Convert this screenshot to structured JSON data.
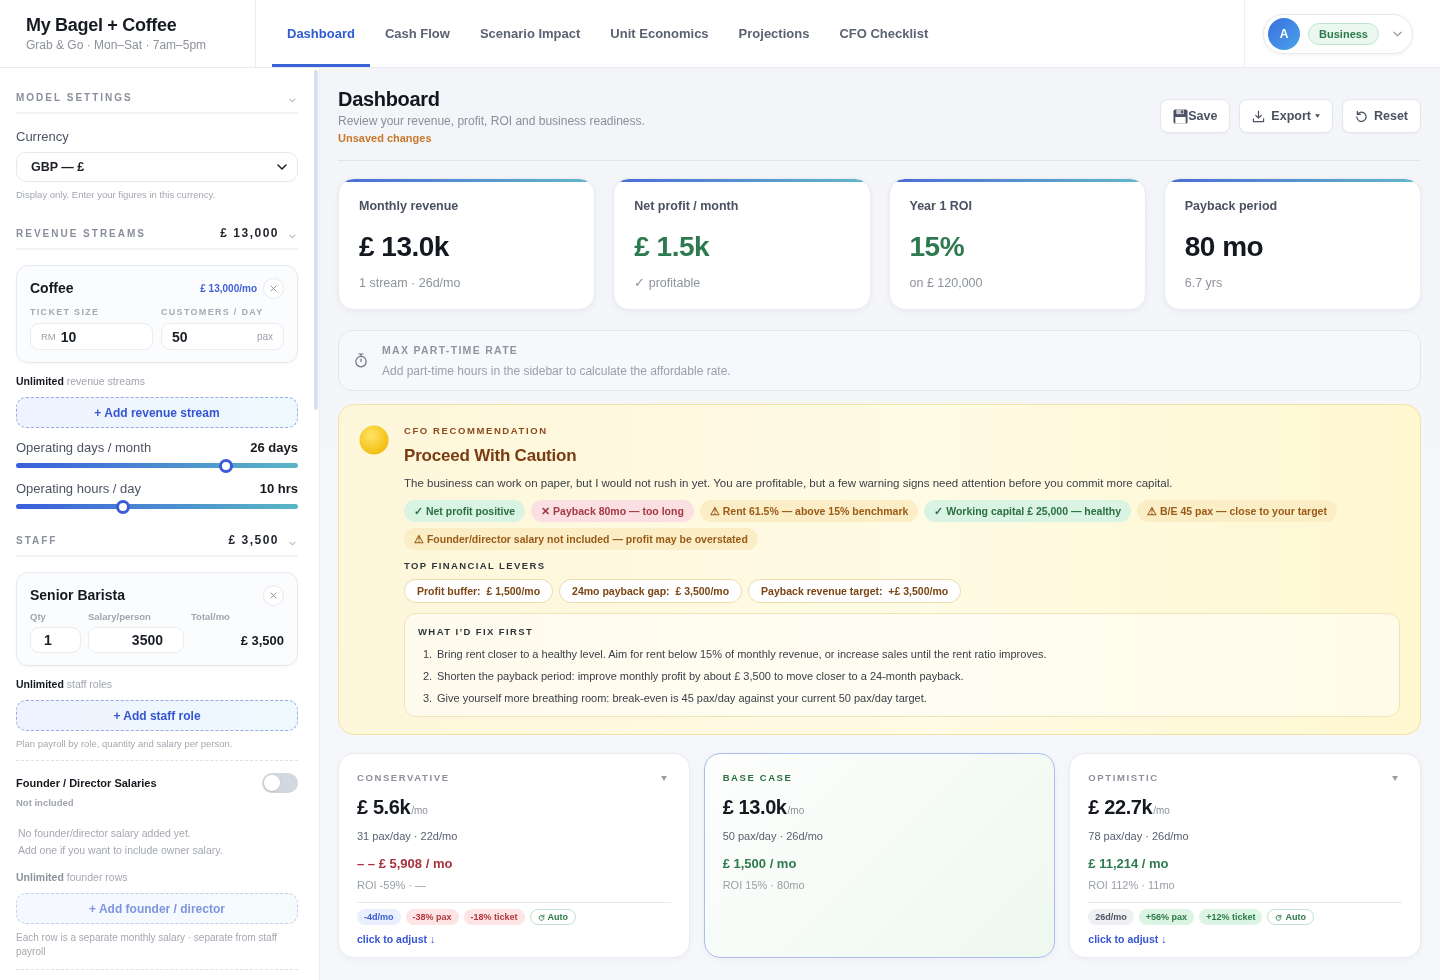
{
  "brand": {
    "title": "My Bagel + Coffee",
    "subtitle": "Grab & Go · Mon–Sat · 7am–5pm"
  },
  "tabs": [
    {
      "label": "Dashboard",
      "selected": true
    },
    {
      "label": "Cash Flow",
      "selected": false
    },
    {
      "label": "Scenario Impact",
      "selected": false
    },
    {
      "label": "Unit Economics",
      "selected": false
    },
    {
      "label": "Projections",
      "selected": false
    },
    {
      "label": "CFO Checklist",
      "selected": false
    }
  ],
  "account": {
    "avatar": "A",
    "plan": "Business"
  },
  "sidebar": {
    "model_settings": {
      "title": "MODEL SETTINGS",
      "currency_label": "Currency",
      "currency_value": "GBP — £",
      "currency_hint": "Display only. Enter your figures in this currency."
    },
    "revenue": {
      "title": "REVENUE STREAMS",
      "total": "£ 13,000",
      "streams": [
        {
          "name": "Coffee",
          "monthly": "£ 13,000/mo",
          "ticket_label": "TICKET SIZE",
          "ticket_prefix": "RM",
          "ticket_value": "10",
          "customers_label": "CUSTOMERS / DAY",
          "customers_value": "50",
          "customers_unit": "pax"
        }
      ],
      "limit_note": "**Unlimited** revenue streams",
      "add_label": "+ Add revenue stream"
    },
    "sliders": [
      {
        "label": "Operating days / month",
        "reading": "26 days",
        "level": 0.745
      },
      {
        "label": "Operating hours / day",
        "reading": "10 hrs",
        "level": 0.38
      }
    ],
    "staff": {
      "title": "STAFF",
      "total": "£ 3,500",
      "roles": [
        {
          "name": "Senior Barista",
          "qty_label": "Qty",
          "qty": "1",
          "salary_label": "Salary/person",
          "salary": "3500",
          "total_label": "Total/mo",
          "total": "£ 3,500"
        }
      ],
      "limit_note": "**Unlimited** staff roles",
      "add_label": "+ Add staff role",
      "hint": "Plan payroll by role, quantity and salary per person."
    },
    "founders": {
      "title": "Founder / Director Salaries",
      "on": false,
      "status": "Not included",
      "empty_lines": [
        "No founder/director salary added yet.",
        "Add one if you want to include owner salary."
      ],
      "limit_note": "**Unlimited** founder rows",
      "add_label": "+ Add founder / director",
      "hint": "Each row is a separate monthly salary · separate from staff payroll"
    }
  },
  "page": {
    "title": "Dashboard",
    "subtitle": "Review your revenue, profit, ROI and business readiness.",
    "status": "Unsaved changes"
  },
  "actions": [
    {
      "label": "Save",
      "kind": "save"
    },
    {
      "label": "Export",
      "kind": "export"
    },
    {
      "label": "Reset",
      "kind": "reset"
    }
  ],
  "kpis": [
    {
      "label": "Monthly revenue",
      "value": "£ 13.0k",
      "note": "1 stream · 26d/mo",
      "kind": "plain"
    },
    {
      "label": "Net profit / month",
      "value": "£ 1.5k",
      "note": "✓ profitable",
      "kind": "positive"
    },
    {
      "label": "Year 1 ROI",
      "value": "15%",
      "note": "on £ 120,000",
      "kind": "positive"
    },
    {
      "label": "Payback period",
      "value": "80 mo",
      "note": "6.7 yrs",
      "kind": "plain"
    }
  ],
  "part_time": {
    "title": "MAX PART-TIME RATE",
    "text": "Add part-time hours in the sidebar to calculate the affordable rate."
  },
  "recommendation": {
    "eyebrow": "CFO RECOMMENDATION",
    "title": "Proceed With Caution",
    "summary": "The business can work on paper, but I would not rush in yet. You are profitable, but a few warning signs need attention before you commit more capital.",
    "signals": [
      {
        "text": "✓ Net profit positive",
        "kind": "good"
      },
      {
        "text": "✕ Payback 80mo — too long",
        "kind": "bad"
      },
      {
        "text": "⚠ Rent 61.5% — above 15% benchmark",
        "kind": "warn"
      },
      {
        "text": "✓ Working capital £ 25,000 — healthy",
        "kind": "good"
      },
      {
        "text": "⚠ B/E 45 pax — close to your target",
        "kind": "warn"
      },
      {
        "text": "⚠ Founder/director salary not included — profit may be overstated",
        "kind": "warn"
      }
    ],
    "levers_title": "TOP FINANCIAL LEVERS",
    "levers": [
      "Profit buffer:  £ 1,500/mo",
      "24mo payback gap:  £ 3,500/mo",
      "Payback revenue target:  +£ 3,500/mo"
    ],
    "fix": {
      "title": "WHAT I’D FIX FIRST",
      "items": [
        {
          "number": "1.",
          "text": "Bring rent closer to a healthy level. Aim for rent below 15% of monthly revenue, or increase sales until the rent ratio improves."
        },
        {
          "number": "2.",
          "text": "Shorten the payback period: improve monthly profit by about £ 3,500 to move closer to a 24-month payback."
        },
        {
          "number": "3.",
          "text": "Give yourself more breathing room: break-even is 45 pax/day against your current 50 pax/day target."
        }
      ]
    }
  },
  "scenarios": [
    {
      "title": "CONSERVATIVE",
      "selected": false,
      "kind": "loss",
      "revenue": "£ 5.6k",
      "unit": "/mo",
      "meta": "31 pax/day · 22d/mo",
      "profit": "– – £ 5,908 / mo",
      "roi": "ROI -59% · —",
      "adjusters": [
        {
          "text": "-4d/mo",
          "kind": "shift"
        },
        {
          "text": "-38% pax",
          "kind": "down"
        },
        {
          "text": "-18% ticket",
          "kind": "down"
        },
        {
          "text": "Auto",
          "kind": "auto"
        }
      ],
      "link": "click to adjust ↓"
    },
    {
      "title": "BASE CASE",
      "selected": true,
      "kind": "gain",
      "revenue": "£ 13.0k",
      "unit": "/mo",
      "meta": "50 pax/day · 26d/mo",
      "profit": "£ 1,500 / mo",
      "roi": "ROI 15% · 80mo"
    },
    {
      "title": "OPTIMISTIC",
      "selected": false,
      "kind": "gain",
      "revenue": "£ 22.7k",
      "unit": "/mo",
      "meta": "78 pax/day · 26d/mo",
      "profit": "£ 11,214 / mo",
      "roi": "ROI 112% · 11mo",
      "adjusters": [
        {
          "text": "26d/mo",
          "kind": "same"
        },
        {
          "text": "+56% pax",
          "kind": "up"
        },
        {
          "text": "+12% ticket",
          "kind": "up"
        },
        {
          "text": "Auto",
          "kind": "auto"
        }
      ],
      "link": "click to adjust ↓"
    }
  ]
}
